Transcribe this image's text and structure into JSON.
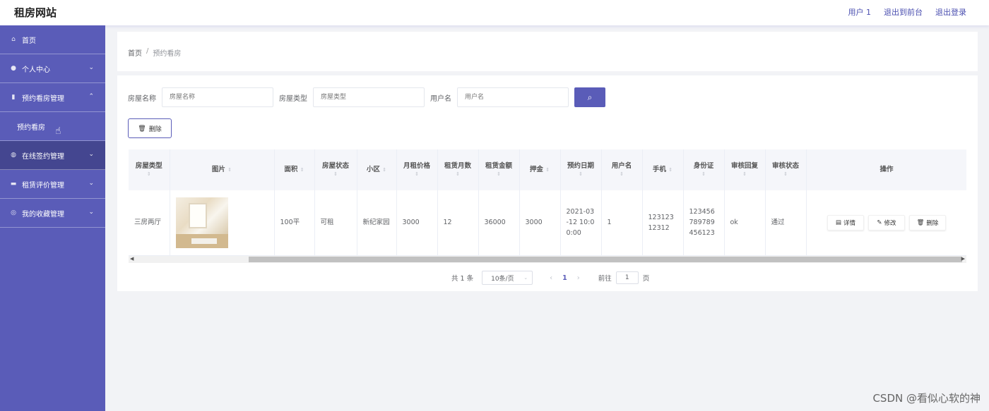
{
  "header": {
    "brand": "租房网站",
    "user": "用户 1",
    "back_to_front": "退出到前台",
    "logout": "退出登录"
  },
  "sidebar": {
    "items": [
      {
        "label": "首页",
        "icon": "home-icon"
      },
      {
        "label": "个人中心",
        "icon": "user-icon"
      },
      {
        "label": "预约看房管理",
        "icon": "clipboard-icon"
      },
      {
        "label": "预约看房",
        "icon": ""
      },
      {
        "label": "在线签约管理",
        "icon": "globe-icon"
      },
      {
        "label": "租赁评价管理",
        "icon": "chat-icon"
      },
      {
        "label": "我的收藏管理",
        "icon": "star-icon"
      }
    ]
  },
  "breadcrumb": {
    "home": "首页",
    "separator": "/",
    "current": "预约看房"
  },
  "search": {
    "name_label": "房屋名称",
    "name_placeholder": "房屋名称",
    "type_label": "房屋类型",
    "type_placeholder": "房屋类型",
    "user_label": "用户名",
    "user_placeholder": "用户名",
    "button_icon": "search-icon"
  },
  "actions": {
    "delete_label": "删除"
  },
  "table": {
    "columns": [
      "房屋类型",
      "图片",
      "面积",
      "房屋状态",
      "小区",
      "月租价格",
      "租赁月数",
      "租赁金额",
      "押金",
      "预约日期",
      "用户名",
      "手机",
      "身份证",
      "审核回复",
      "审核状态",
      "操作"
    ],
    "rows": [
      {
        "type": "三房两厅",
        "area": "100平",
        "status": "可租",
        "community": "新纪家园",
        "monthly_price": "3000",
        "months": "12",
        "amount": "36000",
        "deposit": "3000",
        "date": "2021-03-12 10:00:00",
        "username": "1",
        "phone": "12312312312",
        "id_card": "123456789789456123",
        "reply": "ok",
        "audit": "通过"
      }
    ],
    "op_detail": "详情",
    "op_edit": "修改",
    "op_delete": "删除"
  },
  "pagination": {
    "total": "共 1 条",
    "page_size": "10条/页",
    "current_page": "1",
    "goto_label": "前往",
    "goto_value": "1",
    "page_suffix": "页"
  },
  "watermark": "CSDN @看似心软的神",
  "colors": {
    "accent": "#5a5cb8",
    "sidebar_active": "#444690"
  }
}
